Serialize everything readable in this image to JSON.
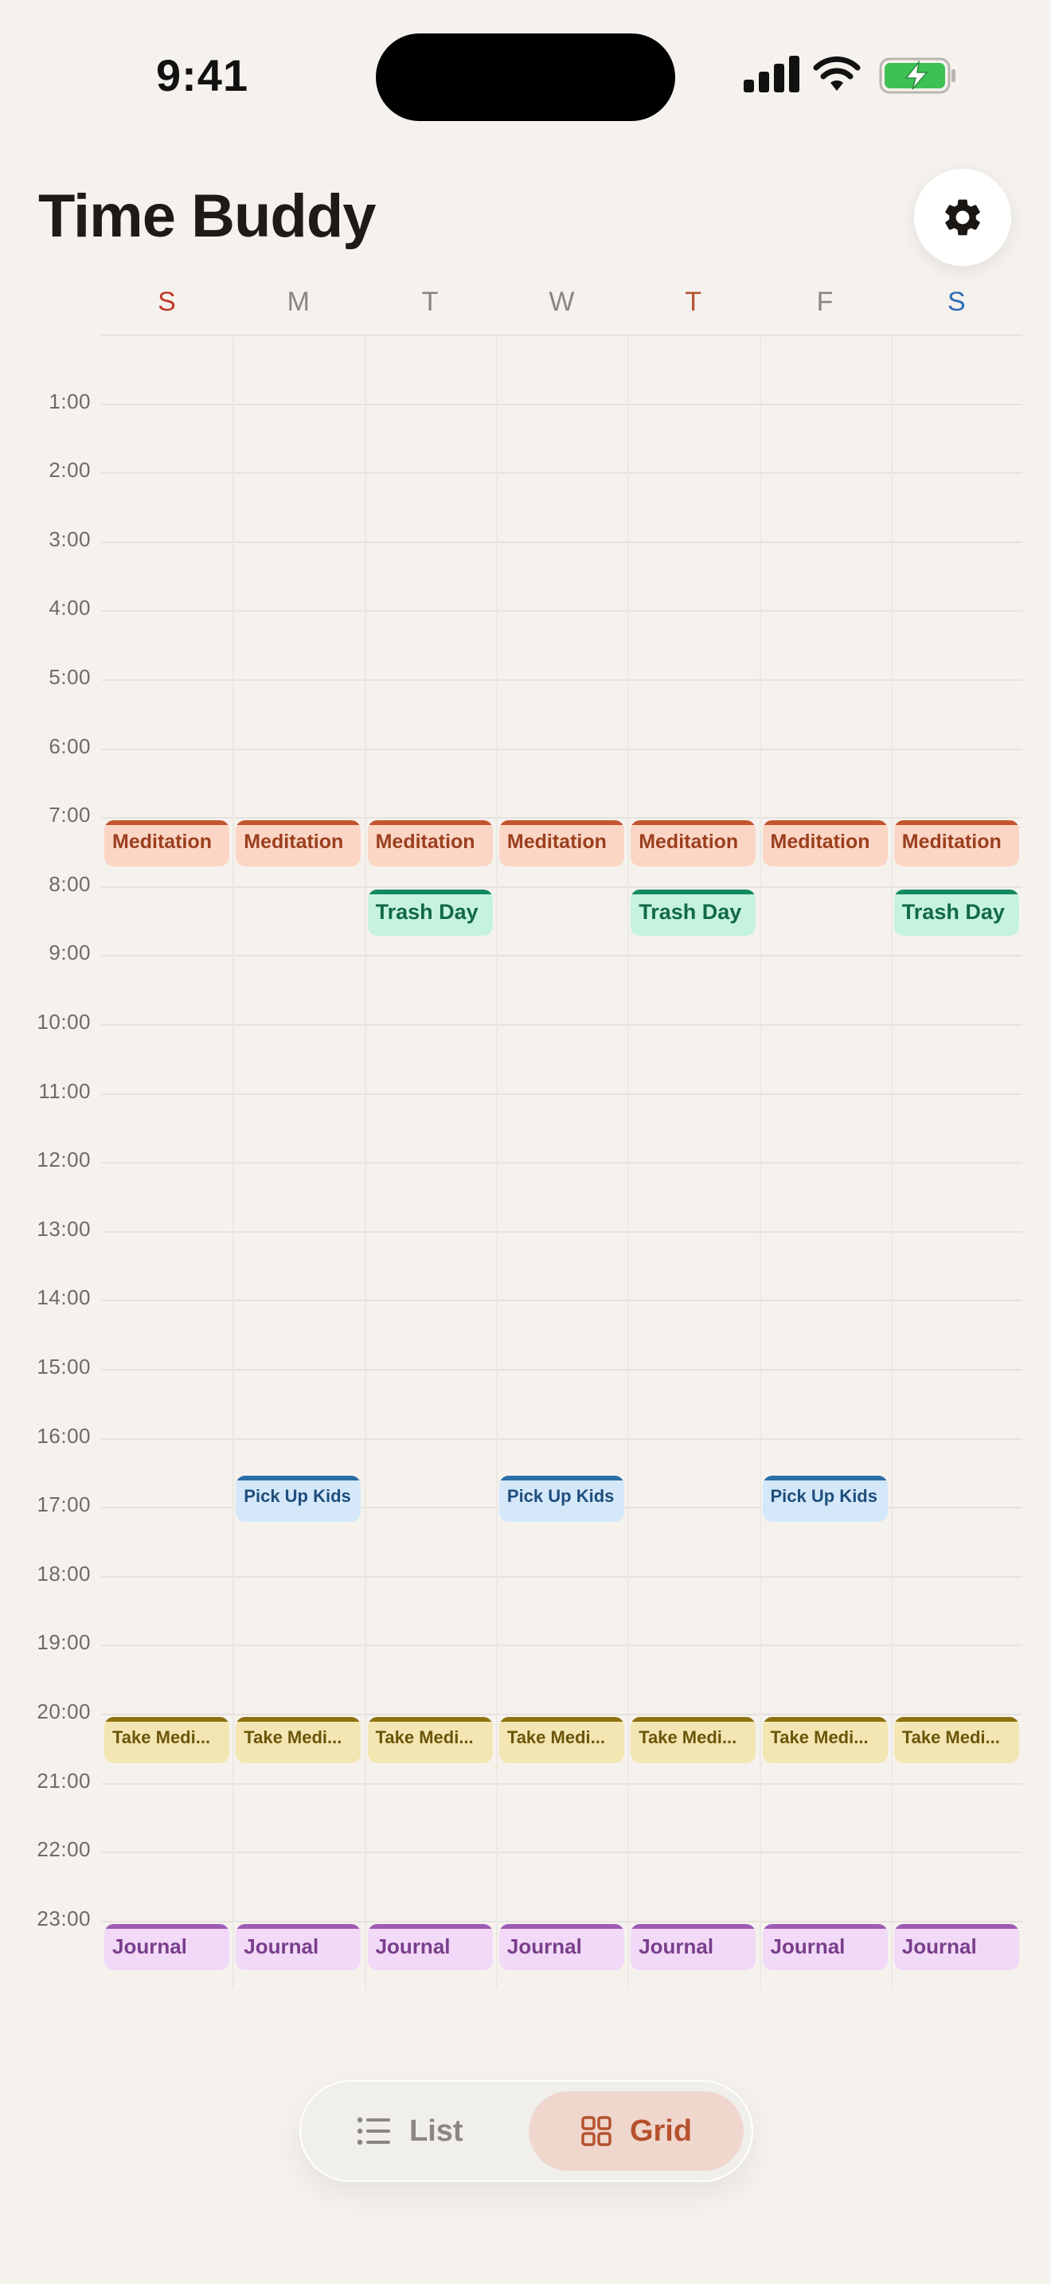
{
  "status_bar": {
    "time": "9:41"
  },
  "header": {
    "title": "Time Buddy"
  },
  "days": [
    {
      "label": "S",
      "color": "#C0392B"
    },
    {
      "label": "M",
      "color": "#8A8581"
    },
    {
      "label": "T",
      "color": "#8A8581"
    },
    {
      "label": "W",
      "color": "#8A8581"
    },
    {
      "label": "T",
      "color": "#B5522E"
    },
    {
      "label": "F",
      "color": "#8A8581"
    },
    {
      "label": "S",
      "color": "#2F6FB6"
    }
  ],
  "hours": [
    "1:00",
    "2:00",
    "3:00",
    "4:00",
    "5:00",
    "6:00",
    "7:00",
    "8:00",
    "9:00",
    "10:00",
    "11:00",
    "12:00",
    "13:00",
    "14:00",
    "15:00",
    "16:00",
    "17:00",
    "18:00",
    "19:00",
    "20:00",
    "21:00",
    "22:00",
    "23:00"
  ],
  "events": [
    {
      "title": "Meditation",
      "hour": 7,
      "type": "med",
      "days": [
        0,
        1,
        2,
        3,
        4,
        5,
        6
      ]
    },
    {
      "title": "Trash Day",
      "hour": 8,
      "type": "trash",
      "days": [
        2,
        4,
        6
      ]
    },
    {
      "title": "Pick Up Kids",
      "hour": 16.5,
      "type": "kids",
      "days": [
        1,
        3,
        5
      ]
    },
    {
      "title": "Take Medi...",
      "hour": 20,
      "type": "take",
      "days": [
        0,
        1,
        2,
        3,
        4,
        5,
        6
      ]
    },
    {
      "title": "Journal",
      "hour": 23,
      "type": "journal",
      "days": [
        0,
        1,
        2,
        3,
        4,
        5,
        6
      ]
    }
  ],
  "view_toggle": {
    "list_label": "List",
    "grid_label": "Grid",
    "selected": "Grid"
  },
  "icons": {
    "settings": "gear-icon",
    "list": "list-icon",
    "grid": "grid-icon"
  }
}
